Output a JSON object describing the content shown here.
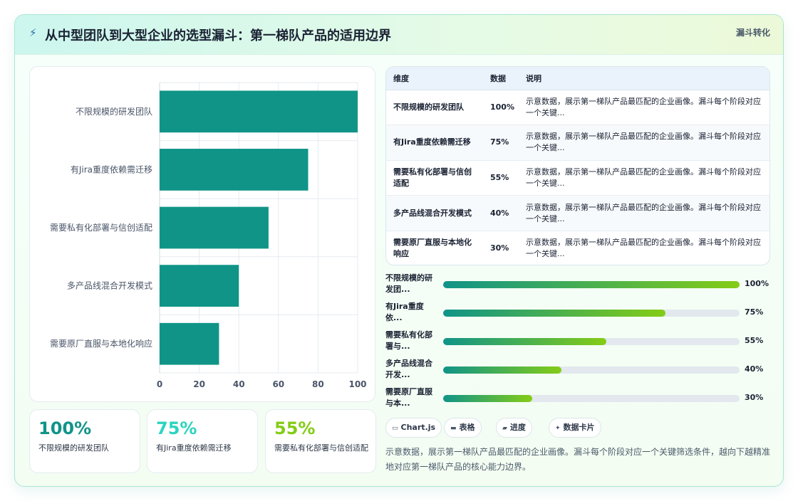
{
  "header": {
    "title": "从中型团队到大型企业的选型漏斗：第一梯队产品的适用边界",
    "tag": "漏斗转化",
    "icon": "lightning-icon"
  },
  "chart_data": {
    "type": "bar",
    "orientation": "horizontal",
    "categories": [
      "不限规模的研发团队",
      "有Jira重度依赖需迁移",
      "需要私有化部署与信创适配",
      "多产品线混合开发模式",
      "需要原厂直服与本地化响应"
    ],
    "values": [
      100,
      75,
      55,
      40,
      30
    ],
    "xlim": [
      0,
      100
    ],
    "xticks": [
      0,
      20,
      40,
      60,
      80,
      100
    ],
    "grid": true,
    "bar_color": "#109488"
  },
  "stats": [
    {
      "value": "100%",
      "label": "不限规模的研发团队",
      "color": "#109488"
    },
    {
      "value": "75%",
      "label": "有Jira重度依赖需迁移",
      "color": "#2dd4bf"
    },
    {
      "value": "55%",
      "label": "需要私有化部署与信创适配",
      "color": "#84cc16"
    }
  ],
  "table": {
    "headers": [
      "维度",
      "数据",
      "说明"
    ],
    "rows": [
      {
        "dim": "不限规模的研发团队",
        "num": "100%",
        "desc": "示意数据，展示第一梯队产品最匹配的企业画像。漏斗每个阶段对应一个关键..."
      },
      {
        "dim": "有Jira重度依赖需迁移",
        "num": "75%",
        "desc": "示意数据，展示第一梯队产品最匹配的企业画像。漏斗每个阶段对应一个关键..."
      },
      {
        "dim": "需要私有化部署与信创适配",
        "num": "55%",
        "desc": "示意数据，展示第一梯队产品最匹配的企业画像。漏斗每个阶段对应一个关键..."
      },
      {
        "dim": "多产品线混合开发模式",
        "num": "40%",
        "desc": "示意数据，展示第一梯队产品最匹配的企业画像。漏斗每个阶段对应一个关键..."
      },
      {
        "dim": "需要原厂直服与本地化响应",
        "num": "30%",
        "desc": "示意数据，展示第一梯队产品最匹配的企业画像。漏斗每个阶段对应一个关键..."
      }
    ]
  },
  "progress": [
    {
      "label": "不限规模的研发团...",
      "value": 100,
      "text": "100%"
    },
    {
      "label": "有Jira重度依...",
      "value": 75,
      "text": "75%"
    },
    {
      "label": "需要私有化部署与...",
      "value": 55,
      "text": "55%"
    },
    {
      "label": "多产品线混合开发...",
      "value": 40,
      "text": "40%"
    },
    {
      "label": "需要原厂直服与本...",
      "value": 30,
      "text": "30%"
    }
  ],
  "chips": [
    {
      "icon": "▭",
      "label": "Chart.js",
      "icon_name": "chart-icon"
    },
    {
      "icon": "▬",
      "label": "表格",
      "icon_name": "table-icon"
    },
    {
      "icon": "▰",
      "label": "进度",
      "icon_name": "progress-icon"
    },
    {
      "icon": "✦",
      "label": "数据卡片",
      "icon_name": "sparkle-icon"
    }
  ],
  "footer": {
    "note": "示意数据，展示第一梯队产品最匹配的企业画像。漏斗每个阶段对应一个关键筛选条件，越向下越精准地对应第一梯队产品的核心能力边界。"
  }
}
